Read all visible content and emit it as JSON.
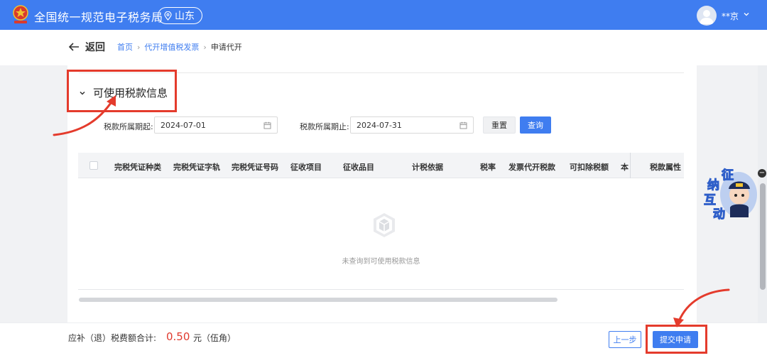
{
  "header": {
    "site_title": "全国统一规范电子税务局",
    "region": "山东",
    "user_name": "**京"
  },
  "nav": {
    "back_label": "返回",
    "breadcrumb": [
      "首页",
      "代开增值税发票",
      "申请代开"
    ]
  },
  "section": {
    "title": "可使用税款信息"
  },
  "filters": {
    "start_label": "税款所属期起:",
    "start_value": "2024-07-01",
    "end_label": "税款所属期止:",
    "end_value": "2024-07-31",
    "reset_label": "重置",
    "query_label": "查询"
  },
  "table": {
    "columns": [
      "完税凭证种类",
      "完税凭证字轨",
      "完税凭证号码",
      "征收项目",
      "征收品目",
      "计税依据",
      "税率",
      "发票代开税款",
      "可扣除税额",
      "本",
      "税款属性"
    ],
    "empty_text": "未查询到可使用税款信息"
  },
  "footer": {
    "total_label": "应补（退）税费额合计:",
    "total_amount": "0.50",
    "total_unit": "元（伍角）",
    "prev_label": "上一步",
    "submit_label": "提交申请"
  },
  "assistant": {
    "chars": [
      "征",
      "纳",
      "互",
      "动"
    ]
  },
  "colors": {
    "primary": "#3f7df0",
    "highlight": "#e43b2c",
    "amount": "#e03b2f"
  }
}
